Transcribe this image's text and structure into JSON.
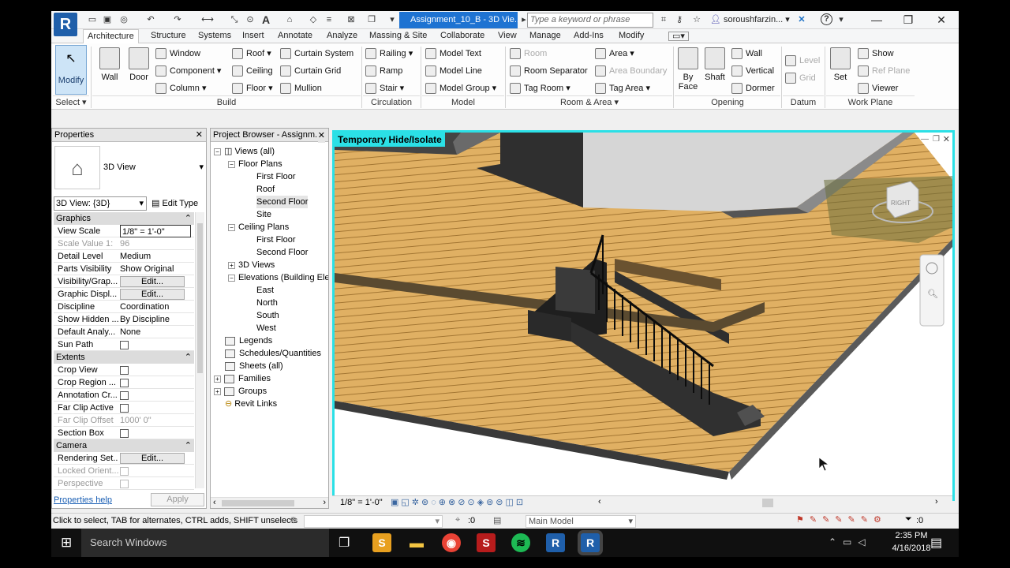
{
  "app": {
    "logo": "R",
    "doc_tab": "Assignment_10_B - 3D Vie...",
    "search_placeholder": "Type a keyword or phrase",
    "user": "soroushfarzin...",
    "help": "?"
  },
  "ribbon_tabs": [
    "Architecture",
    "Structure",
    "Systems",
    "Insert",
    "Annotate",
    "Analyze",
    "Massing & Site",
    "Collaborate",
    "View",
    "Manage",
    "Add-Ins",
    "Modify"
  ],
  "ribbon": {
    "modify": "Modify",
    "select": "Select ▾",
    "wall": "Wall",
    "door": "Door",
    "window": "Window",
    "component": "Component",
    "column": "Column",
    "roof": "Roof",
    "ceiling": "Ceiling",
    "floor": "Floor",
    "curtain_system": "Curtain System",
    "curtain_grid": "Curtain Grid",
    "mullion": "Mullion",
    "build": "Build",
    "railing": "Railing",
    "ramp": "Ramp",
    "stair": "Stair",
    "circulation": "Circulation",
    "model_text": "Model Text",
    "model_line": "Model Line",
    "model_group": "Model Group",
    "model": "Model",
    "room": "Room",
    "room_separator": "Room Separator",
    "tag_room": "Tag Room",
    "area": "Area",
    "area_boundary": "Area Boundary",
    "tag_area": "Tag Area",
    "room_area": "Room & Area ▾",
    "by_face": "By Face",
    "shaft": "Shaft",
    "wall_open": "Wall",
    "vertical": "Vertical",
    "dormer": "Dormer",
    "opening": "Opening",
    "level": "Level",
    "grid": "Grid",
    "datum": "Datum",
    "set": "Set",
    "show": "Show",
    "ref_plane": "Ref Plane",
    "viewer": "Viewer",
    "work_plane": "Work Plane"
  },
  "properties": {
    "title": "Properties",
    "type_name": "3D View",
    "instance": "3D View: {3D}",
    "edit_type": "Edit Type",
    "sections": {
      "graphics": "Graphics",
      "extents": "Extents",
      "camera": "Camera"
    },
    "rows": [
      {
        "k": "View Scale",
        "v": "1/8\" = 1'-0\""
      },
      {
        "k": "Scale Value    1:",
        "v": "96"
      },
      {
        "k": "Detail Level",
        "v": "Medium"
      },
      {
        "k": "Parts Visibility",
        "v": "Show Original"
      },
      {
        "k": "Visibility/Grap...",
        "v": "Edit..."
      },
      {
        "k": "Graphic Displ...",
        "v": "Edit..."
      },
      {
        "k": "Discipline",
        "v": "Coordination"
      },
      {
        "k": "Show Hidden ...",
        "v": "By Discipline"
      },
      {
        "k": "Default Analy...",
        "v": "None"
      },
      {
        "k": "Sun Path",
        "v": ""
      },
      {
        "k": "Crop View",
        "v": ""
      },
      {
        "k": "Crop Region ...",
        "v": ""
      },
      {
        "k": "Annotation Cr...",
        "v": ""
      },
      {
        "k": "Far Clip Active",
        "v": ""
      },
      {
        "k": "Far Clip Offset",
        "v": "1000'  0\""
      },
      {
        "k": "Section Box",
        "v": ""
      },
      {
        "k": "Rendering Set...",
        "v": "Edit..."
      },
      {
        "k": "Locked Orient...",
        "v": ""
      },
      {
        "k": "Perspective",
        "v": ""
      }
    ],
    "help": "Properties help",
    "apply": "Apply"
  },
  "browser": {
    "title": "Project Browser - Assignm...",
    "items": [
      "Views (all)",
      "Floor Plans",
      "First Floor",
      "Roof",
      "Second Floor",
      "Site",
      "Ceiling Plans",
      "First Floor",
      "Second Floor",
      "3D Views",
      "Elevations (Building Ele",
      "East",
      "North",
      "South",
      "West",
      "Legends",
      "Schedules/Quantities",
      "Sheets (all)",
      "Families",
      "Groups",
      "Revit Links"
    ]
  },
  "viewport": {
    "tag": "Temporary Hide/Isolate",
    "viewcube": "RIGHT",
    "scale": "1/8\" = 1'-0\""
  },
  "status": {
    "hint": "Click to select, TAB for alternates, CTRL adds, SHIFT unselects",
    "sel_count": ":0",
    "model": "Main Model",
    "filter": ":0"
  },
  "taskbar": {
    "search": "Search Windows",
    "time": "2:35 PM",
    "date": "4/16/2018"
  },
  "colors": {
    "accent": "#1e73d2",
    "viewport_border": "#2be0e6",
    "floor": "#d9a85a"
  }
}
